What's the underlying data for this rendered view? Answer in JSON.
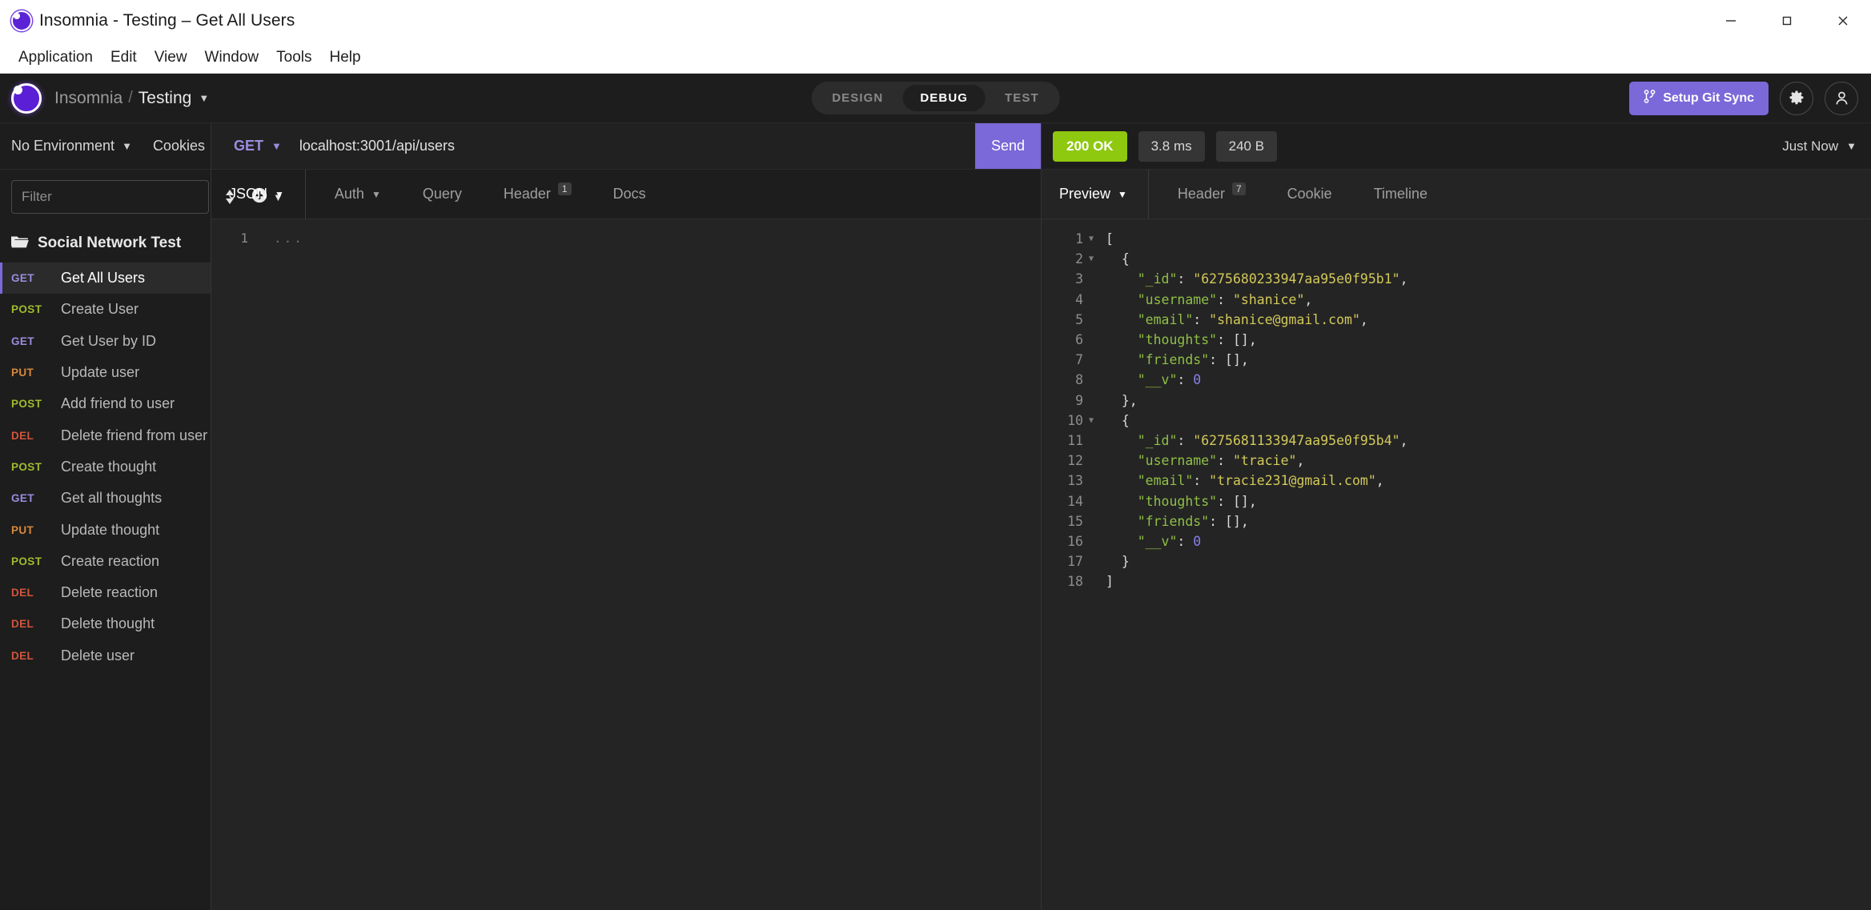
{
  "window": {
    "title": "Insomnia - Testing – Get All Users",
    "logo_icon": "insomnia-logo-icon",
    "minimize_icon": "minimize-icon",
    "maximize_icon": "maximize-icon",
    "close_icon": "close-icon"
  },
  "menubar": {
    "items": [
      {
        "label": "Application"
      },
      {
        "label": "Edit"
      },
      {
        "label": "View"
      },
      {
        "label": "Window"
      },
      {
        "label": "Tools"
      },
      {
        "label": "Help"
      }
    ]
  },
  "header": {
    "logo_icon": "insomnia-logo-icon",
    "breadcrumb_root": "Insomnia",
    "breadcrumb_sep": "/",
    "breadcrumb_current": "Testing",
    "workspace_caret_icon": "chevron-down-icon",
    "modes": [
      {
        "label": "DESIGN",
        "active": false
      },
      {
        "label": "DEBUG",
        "active": true
      },
      {
        "label": "TEST",
        "active": false
      }
    ],
    "git_sync_label": "Setup Git Sync",
    "git_sync_icon": "git-branch-icon",
    "git_sync_color": "#7b68d9",
    "settings_icon": "gear-icon",
    "account_icon": "account-icon"
  },
  "sidebar": {
    "environment_label": "No Environment",
    "environment_caret_icon": "chevron-down-icon",
    "cookies_label": "Cookies",
    "filter_placeholder": "Filter",
    "filter_value": "",
    "sort_icon": "sort-icon",
    "add_icon": "plus-circle-icon",
    "add_caret_icon": "chevron-down-icon",
    "folder_icon": "folder-icon",
    "folder_name": "Social Network Test",
    "requests": [
      {
        "method": "GET",
        "name": "Get All Users",
        "active": true
      },
      {
        "method": "POST",
        "name": "Create User",
        "active": false
      },
      {
        "method": "GET",
        "name": "Get User by ID",
        "active": false
      },
      {
        "method": "PUT",
        "name": "Update user",
        "active": false
      },
      {
        "method": "POST",
        "name": "Add friend to user",
        "active": false
      },
      {
        "method": "DEL",
        "name": "Delete friend from user",
        "active": false
      },
      {
        "method": "POST",
        "name": "Create thought",
        "active": false
      },
      {
        "method": "GET",
        "name": "Get all thoughts",
        "active": false
      },
      {
        "method": "PUT",
        "name": "Update thought",
        "active": false
      },
      {
        "method": "POST",
        "name": "Create reaction",
        "active": false
      },
      {
        "method": "DEL",
        "name": "Delete reaction",
        "active": false
      },
      {
        "method": "DEL",
        "name": "Delete thought",
        "active": false
      },
      {
        "method": "DEL",
        "name": "Delete user",
        "active": false
      }
    ],
    "method_colors": {
      "GET": "#9c8ce0",
      "POST": "#9fbb2e",
      "PUT": "#d8893b",
      "DEL": "#d2553d"
    }
  },
  "request": {
    "method": "GET",
    "method_caret_icon": "chevron-down-icon",
    "url": "localhost:3001/api/users",
    "send_label": "Send",
    "tabs": [
      {
        "label": "JSON",
        "active": true,
        "caret": true,
        "badge": ""
      },
      {
        "label": "Auth",
        "active": false,
        "caret": true,
        "badge": ""
      },
      {
        "label": "Query",
        "active": false,
        "caret": false,
        "badge": ""
      },
      {
        "label": "Header",
        "active": false,
        "caret": false,
        "badge": "1"
      },
      {
        "label": "Docs",
        "active": false,
        "caret": false,
        "badge": ""
      }
    ],
    "body_line_number": "1",
    "body_placeholder": "..."
  },
  "response": {
    "status": "200 OK",
    "status_color": "#8ec80f",
    "time": "3.8 ms",
    "size": "240 B",
    "history_label": "Just Now",
    "history_caret_icon": "chevron-down-icon",
    "tabs": [
      {
        "label": "Preview",
        "active": true,
        "caret": true,
        "badge": ""
      },
      {
        "label": "Header",
        "active": false,
        "caret": false,
        "badge": "7"
      },
      {
        "label": "Cookie",
        "active": false,
        "caret": false,
        "badge": ""
      },
      {
        "label": "Timeline",
        "active": false,
        "caret": false,
        "badge": ""
      }
    ],
    "body_lines": [
      {
        "n": "1",
        "fold": "down",
        "tokens": [
          {
            "t": "[",
            "c": "p"
          }
        ]
      },
      {
        "n": "2",
        "fold": "down",
        "tokens": [
          {
            "t": "  {",
            "c": "p"
          }
        ]
      },
      {
        "n": "3",
        "fold": "",
        "tokens": [
          {
            "t": "    ",
            "c": "p"
          },
          {
            "t": "\"_id\"",
            "c": "k"
          },
          {
            "t": ": ",
            "c": "p"
          },
          {
            "t": "\"6275680233947aa95e0f95b1\"",
            "c": "s"
          },
          {
            "t": ",",
            "c": "p"
          }
        ]
      },
      {
        "n": "4",
        "fold": "",
        "tokens": [
          {
            "t": "    ",
            "c": "p"
          },
          {
            "t": "\"username\"",
            "c": "k"
          },
          {
            "t": ": ",
            "c": "p"
          },
          {
            "t": "\"shanice\"",
            "c": "s"
          },
          {
            "t": ",",
            "c": "p"
          }
        ]
      },
      {
        "n": "5",
        "fold": "",
        "tokens": [
          {
            "t": "    ",
            "c": "p"
          },
          {
            "t": "\"email\"",
            "c": "k"
          },
          {
            "t": ": ",
            "c": "p"
          },
          {
            "t": "\"shanice@gmail.com\"",
            "c": "s"
          },
          {
            "t": ",",
            "c": "p"
          }
        ]
      },
      {
        "n": "6",
        "fold": "",
        "tokens": [
          {
            "t": "    ",
            "c": "p"
          },
          {
            "t": "\"thoughts\"",
            "c": "k"
          },
          {
            "t": ": [],",
            "c": "p"
          }
        ]
      },
      {
        "n": "7",
        "fold": "",
        "tokens": [
          {
            "t": "    ",
            "c": "p"
          },
          {
            "t": "\"friends\"",
            "c": "k"
          },
          {
            "t": ": [],",
            "c": "p"
          }
        ]
      },
      {
        "n": "8",
        "fold": "",
        "tokens": [
          {
            "t": "    ",
            "c": "p"
          },
          {
            "t": "\"__v\"",
            "c": "k"
          },
          {
            "t": ": ",
            "c": "p"
          },
          {
            "t": "0",
            "c": "n"
          }
        ]
      },
      {
        "n": "9",
        "fold": "",
        "tokens": [
          {
            "t": "  },",
            "c": "p"
          }
        ]
      },
      {
        "n": "10",
        "fold": "down",
        "tokens": [
          {
            "t": "  {",
            "c": "p"
          }
        ]
      },
      {
        "n": "11",
        "fold": "",
        "tokens": [
          {
            "t": "    ",
            "c": "p"
          },
          {
            "t": "\"_id\"",
            "c": "k"
          },
          {
            "t": ": ",
            "c": "p"
          },
          {
            "t": "\"6275681133947aa95e0f95b4\"",
            "c": "s"
          },
          {
            "t": ",",
            "c": "p"
          }
        ]
      },
      {
        "n": "12",
        "fold": "",
        "tokens": [
          {
            "t": "    ",
            "c": "p"
          },
          {
            "t": "\"username\"",
            "c": "k"
          },
          {
            "t": ": ",
            "c": "p"
          },
          {
            "t": "\"tracie\"",
            "c": "s"
          },
          {
            "t": ",",
            "c": "p"
          }
        ]
      },
      {
        "n": "13",
        "fold": "",
        "tokens": [
          {
            "t": "    ",
            "c": "p"
          },
          {
            "t": "\"email\"",
            "c": "k"
          },
          {
            "t": ": ",
            "c": "p"
          },
          {
            "t": "\"tracie231@gmail.com\"",
            "c": "s"
          },
          {
            "t": ",",
            "c": "p"
          }
        ]
      },
      {
        "n": "14",
        "fold": "",
        "tokens": [
          {
            "t": "    ",
            "c": "p"
          },
          {
            "t": "\"thoughts\"",
            "c": "k"
          },
          {
            "t": ": [],",
            "c": "p"
          }
        ]
      },
      {
        "n": "15",
        "fold": "",
        "tokens": [
          {
            "t": "    ",
            "c": "p"
          },
          {
            "t": "\"friends\"",
            "c": "k"
          },
          {
            "t": ": [],",
            "c": "p"
          }
        ]
      },
      {
        "n": "16",
        "fold": "",
        "tokens": [
          {
            "t": "    ",
            "c": "p"
          },
          {
            "t": "\"__v\"",
            "c": "k"
          },
          {
            "t": ": ",
            "c": "p"
          },
          {
            "t": "0",
            "c": "n"
          }
        ]
      },
      {
        "n": "17",
        "fold": "",
        "tokens": [
          {
            "t": "  }",
            "c": "p"
          }
        ]
      },
      {
        "n": "18",
        "fold": "",
        "tokens": [
          {
            "t": "]",
            "c": "p"
          }
        ]
      }
    ]
  }
}
